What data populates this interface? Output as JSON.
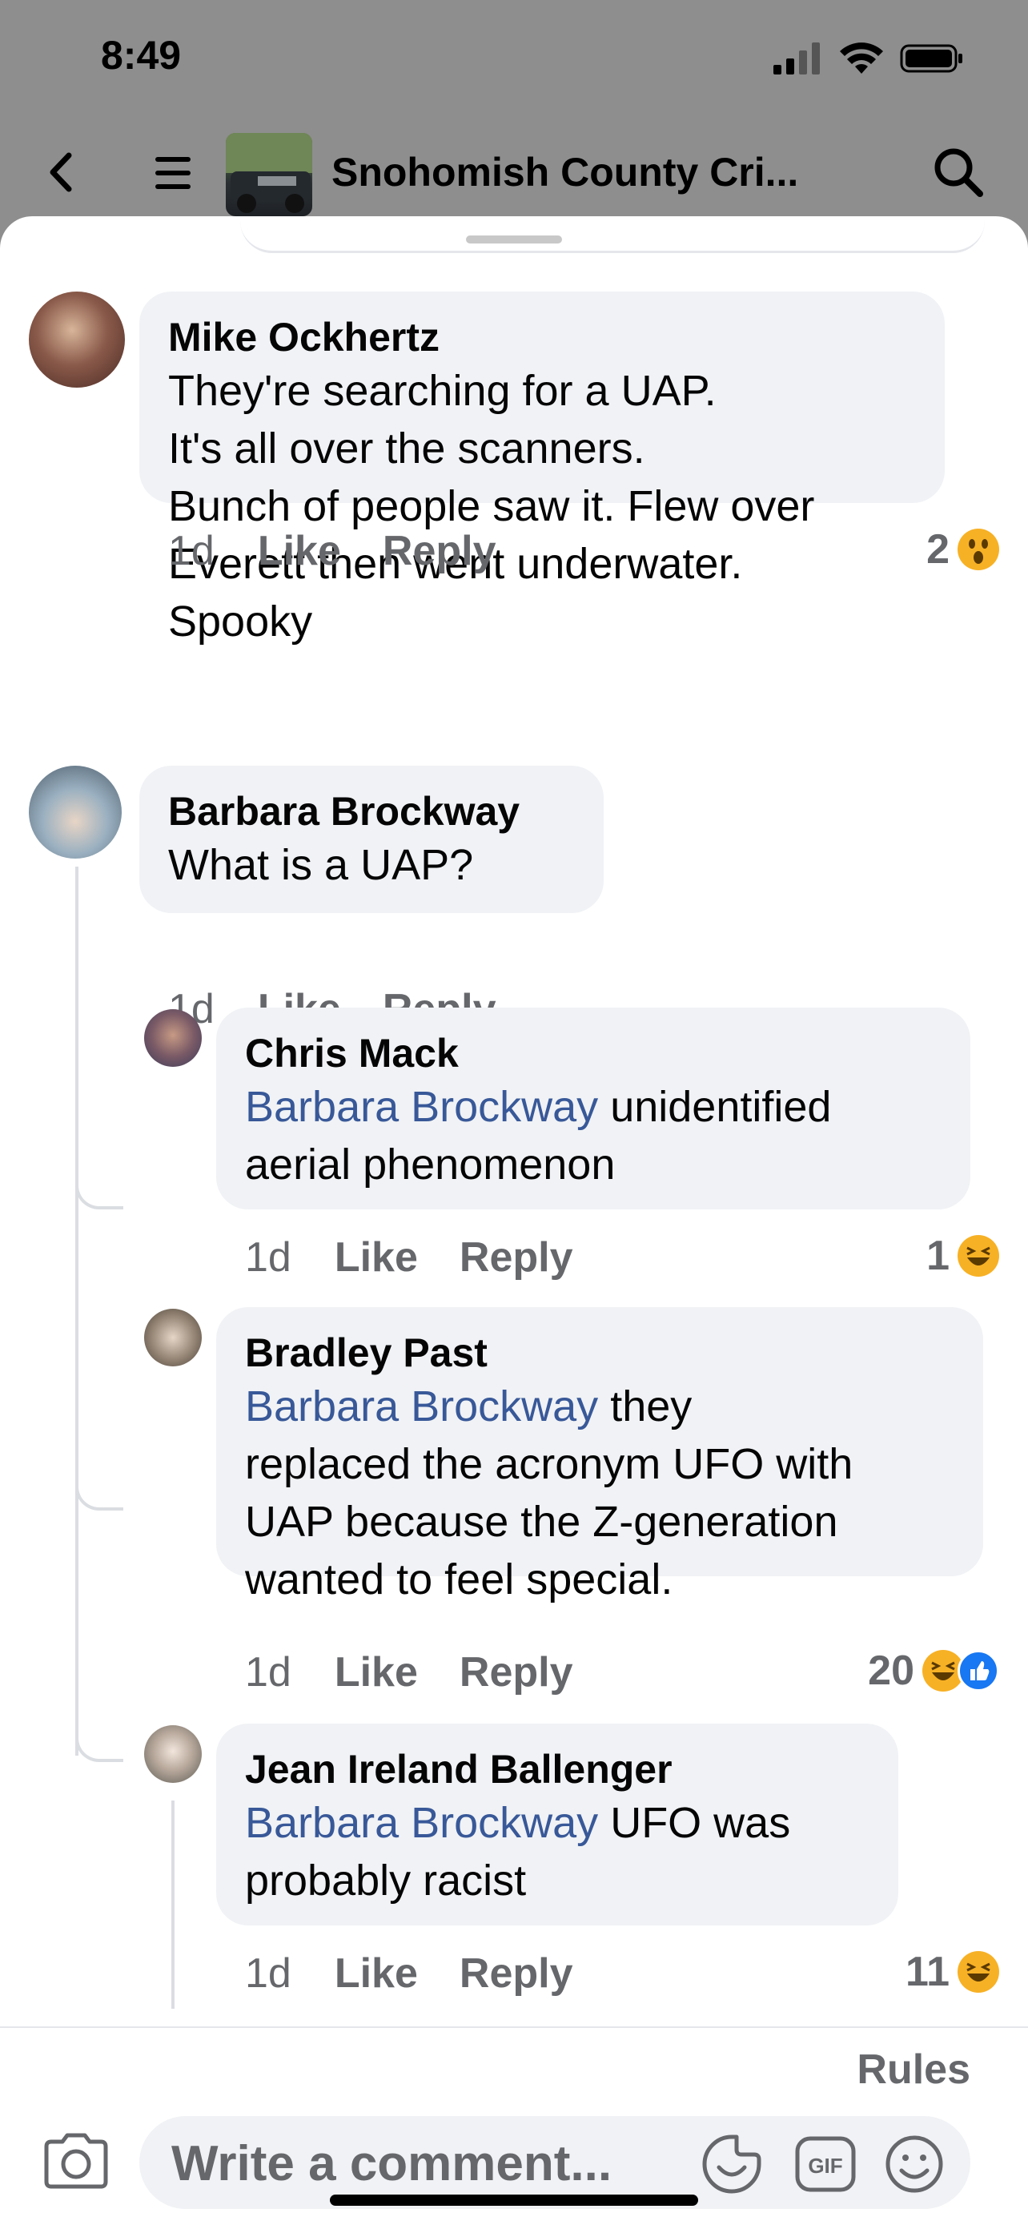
{
  "status": {
    "time": "8:49"
  },
  "header": {
    "group_title": "Snohomish County Cri..."
  },
  "comments": [
    {
      "author": "Mike Ockhertz",
      "lines": [
        "They're searching for a UAP.",
        "It's all over the scanners.",
        "Bunch of people saw it. Flew over",
        "Everett then went underwater.",
        "Spooky"
      ],
      "time": "1d",
      "like": "Like",
      "reply": "Reply",
      "reaction_count": "2",
      "reaction_icon": "wow-emoji-icon"
    },
    {
      "author": "Barbara Brockway",
      "lines": [
        "What is a UAP?"
      ],
      "time": "1d",
      "like": "Like",
      "reply": "Reply"
    }
  ],
  "replies": [
    {
      "author": "Chris Mack",
      "mention": "Barbara Brockway",
      "first_line_rest": " unidentified",
      "lines": [
        "aerial phenomenon"
      ],
      "time": "1d",
      "like": "Like",
      "reply": "Reply",
      "reaction_count": "1",
      "reaction_icon": "haha-emoji-icon"
    },
    {
      "author": "Bradley Past",
      "mention": "Barbara Brockway",
      "first_line_rest": " they",
      "lines": [
        "replaced the acronym UFO with",
        "UAP because the Z-generation",
        "wanted to feel special."
      ],
      "time": "1d",
      "like": "Like",
      "reply": "Reply",
      "reaction_count": "20",
      "reaction_icon": "haha-emoji-icon"
    },
    {
      "author": "Jean Ireland Ballenger",
      "mention": "Barbara Brockway",
      "first_line_rest": " UFO was",
      "lines": [
        "probably racist"
      ],
      "time": "1d",
      "like": "Like",
      "reply": "Reply",
      "reaction_count": "11",
      "reaction_icon": "haha-emoji-icon"
    }
  ],
  "composer": {
    "rules": "Rules",
    "placeholder": "Write a comment..."
  },
  "colors": {
    "mention": "#385898",
    "bubble": "#f0f2f5",
    "meta": "#65676b",
    "reaction_yellow": "#f7b125",
    "like_blue": "#1877f2"
  }
}
